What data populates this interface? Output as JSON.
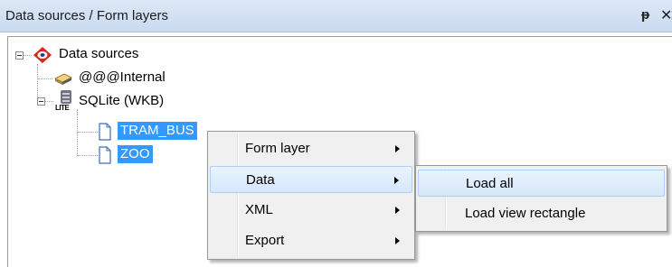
{
  "window": {
    "title": "Data sources / Form layers",
    "pin_glyph": "ᵽ",
    "close_glyph": "✕"
  },
  "tree": {
    "root": {
      "label": "Data sources",
      "icon": "data-sources-icon"
    },
    "internal": {
      "label": "@@@Internal",
      "icon": "internal-source-icon"
    },
    "sqlite": {
      "label": "SQLite (WKB)",
      "icon": "sqlite-database-icon",
      "icon_text": "LITE"
    },
    "layers": [
      {
        "label": "TRAM_BUS",
        "selected": true
      },
      {
        "label": "ZOO",
        "selected": true
      }
    ]
  },
  "context_menu": {
    "items": [
      {
        "label": "Form layer",
        "has_submenu": true
      },
      {
        "label": "Data",
        "has_submenu": true,
        "highlighted": true
      },
      {
        "label": "XML",
        "has_submenu": true
      },
      {
        "label": "Export",
        "has_submenu": true
      }
    ]
  },
  "submenu": {
    "items": [
      {
        "label": "Load all",
        "highlighted": true
      },
      {
        "label": "Load view rectangle"
      }
    ]
  },
  "colors": {
    "selection": "#3399ff",
    "menu_bg": "#f0f0f0",
    "titlebar": "#c9daf0"
  }
}
